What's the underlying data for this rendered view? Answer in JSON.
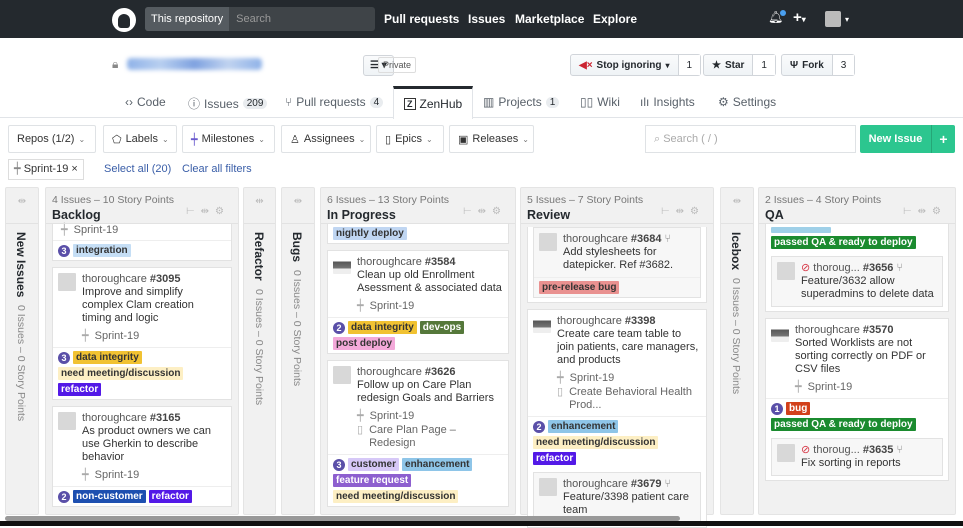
{
  "topnav": {
    "scope": "This repository",
    "search_placeholder": "Search",
    "links": [
      "Pull requests",
      "Issues",
      "Marketplace",
      "Explore"
    ]
  },
  "repo": {
    "visibility": "Private",
    "watch": {
      "label": "Stop ignoring",
      "count": "1"
    },
    "star": {
      "label": "Star",
      "count": "1"
    },
    "fork": {
      "label": "Fork",
      "count": "3"
    }
  },
  "tabs": [
    {
      "label": "Code",
      "icon": "<>"
    },
    {
      "label": "Issues",
      "count": "209"
    },
    {
      "label": "Pull requests",
      "count": "4"
    },
    {
      "label": "ZenHub",
      "selected": true
    },
    {
      "label": "Projects",
      "count": "1"
    },
    {
      "label": "Wiki"
    },
    {
      "label": "Insights"
    },
    {
      "label": "Settings"
    }
  ],
  "filters": {
    "repos": "Repos (1/2)",
    "labels": "Labels",
    "milestones": "Milestones",
    "assignees": "Assignees",
    "epics": "Epics",
    "releases": "Releases",
    "search_placeholder": "Search ( / )",
    "new_issue": "New Issue",
    "new_issue_plus": "+"
  },
  "active_filters": {
    "chip": "Sprint-19",
    "chip_close": "×",
    "select_all": "Select all (20)",
    "clear_all": "Clear all filters"
  },
  "collapsed": [
    {
      "name": "New Issues",
      "meta": "0 Issues – 0 Story Points"
    },
    {
      "name": "Refactor",
      "meta": "0 Issues – 0 Story Points"
    },
    {
      "name": "Bugs",
      "meta": "0 Issues – 0 Story Points"
    },
    {
      "name": "Icebox",
      "meta": "0 Issues – 0 Story Points"
    }
  ],
  "colors": {
    "integration": "#c5def5",
    "data integrity": "#f1c232",
    "need meeting/discussion": "#fdefc4",
    "refactor": "#5319e7",
    "non-customer": "#1d4fb0",
    "nightly deploy": "#c0d6f2",
    "dev-ops": "#55783a",
    "post deploy": "#f3a9d9",
    "customer": "#d6c8f7",
    "enhancement": "#8ec5e8",
    "feature request": "#8d5fcf",
    "pre-release bug": "#e99190",
    "passed QA & ready to deploy": "#1b8b2f",
    "bug": "#d2401a",
    "": "#9fd0e8"
  },
  "columns": [
    {
      "name": "Backlog",
      "meta": "4 Issues – 10 Story Points",
      "cards": [
        {
          "cut": true,
          "sprint": "Sprint-19",
          "estimate": "3",
          "labels": [
            "integration"
          ]
        },
        {
          "author": "thoroughcare",
          "number": "#3095",
          "title": "Improve and simplify complex Clam creation timing and logic",
          "sprint": "Sprint-19",
          "estimate": "3",
          "labels": [
            "data integrity",
            "need meeting/discussion",
            "refactor"
          ]
        },
        {
          "author": "thoroughcare",
          "number": "#3165",
          "title": "As product owners we can use Gherkin to describe behavior",
          "sprint": "Sprint-19",
          "estimate": "2",
          "labels": [
            "non-customer",
            "refactor"
          ]
        }
      ]
    },
    {
      "name": "In Progress",
      "meta": "6 Issues – 13 Story Points",
      "cards": [
        {
          "cut": true,
          "labels": [
            "nightly deploy"
          ]
        },
        {
          "author": "thoroughcare",
          "number": "#3584",
          "photo": true,
          "title": "Clean up old Enrollment Asessment & associated data",
          "sprint": "Sprint-19",
          "estimate": "2",
          "labels": [
            "data integrity",
            "dev-ops",
            "post deploy"
          ]
        },
        {
          "author": "thoroughcare",
          "number": "#3626",
          "title": "Follow up on Care Plan redesign Goals and Barriers",
          "sprint": "Sprint-19",
          "epic": "Care Plan Page – Redesign",
          "estimate": "3",
          "labels": [
            "customer",
            "enhancement",
            "feature request",
            "need meeting/discussion"
          ]
        }
      ]
    },
    {
      "name": "Review",
      "meta": "5 Issues – 7 Story Points",
      "cards": [
        {
          "cut": true,
          "subs": [
            {
              "author": "thoroughcare",
              "number": "#3684",
              "title": "Add stylesheets for datepicker. Ref #3682.",
              "labels": [
                "pre-release bug"
              ]
            }
          ]
        },
        {
          "author": "thoroughcare",
          "number": "#3398",
          "photo": true,
          "title": "Create care team table to join patients, care managers, and products",
          "sprint": "Sprint-19",
          "epic": "Create Behavioral Health Prod...",
          "estimate": "2",
          "labels": [
            "enhancement",
            "need meeting/discussion",
            "refactor"
          ],
          "subs": [
            {
              "author": "thoroughcare",
              "number": "#3679",
              "title": "Feature/3398 patient care team"
            }
          ]
        }
      ]
    },
    {
      "name": "QA",
      "meta": "2 Issues – 4 Story Points",
      "cards": [
        {
          "cut": true,
          "labels": [
            "",
            "passed QA & ready to deploy"
          ],
          "subs": [
            {
              "blocked": true,
              "author": "thoroug...",
              "number": "#3656",
              "title": "Feature/3632 allow superadmins to delete data"
            }
          ]
        },
        {
          "author": "thoroughcare",
          "number": "#3570",
          "photo": true,
          "title": "Sorted Worklists are not sorting correctly on PDF or CSV files",
          "sprint": "Sprint-19",
          "estimate": "1",
          "labels": [
            "bug",
            "passed QA & ready to deploy"
          ],
          "subs": [
            {
              "blocked": true,
              "author": "thoroug...",
              "number": "#3635",
              "title": "Fix sorting in reports"
            }
          ]
        }
      ]
    }
  ]
}
